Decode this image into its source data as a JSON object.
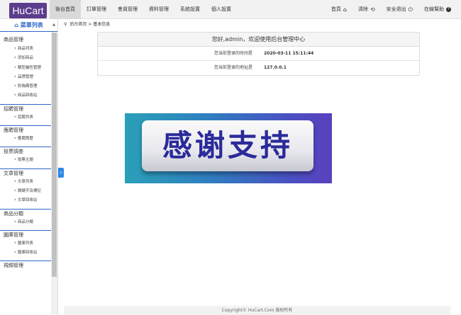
{
  "header": {
    "logo": "HuCart",
    "nav": [
      "後台首頁",
      "訂單管理",
      "會員管理",
      "資料管理",
      "系統設置",
      "個人設置"
    ],
    "right": [
      {
        "label": "首頁",
        "icon": "⌂"
      },
      {
        "label": "清除",
        "icon": "⟲"
      },
      {
        "label": "安全退出",
        "icon": "⏻"
      },
      {
        "label": "在線幫助",
        "icon": "?"
      }
    ]
  },
  "sidebar": {
    "title": "菜單列表",
    "groups": [
      {
        "title": "商品管理",
        "items": [
          "商品列表",
          "添加商品",
          "類型屬性管理",
          "品牌管理",
          "防偽碼管理",
          "商品回收站"
        ]
      },
      {
        "title": "招聘管理",
        "items": [
          "招聘列表"
        ]
      },
      {
        "title": "應聘管理",
        "items": [
          "應聘簡歷"
        ]
      },
      {
        "title": "投票調查",
        "items": [
          "投票主題"
        ]
      },
      {
        "title": "文章管理",
        "items": [
          "文章列表",
          "關鍵字及標記",
          "文章回收站"
        ]
      },
      {
        "title": "商品分類",
        "items": [
          "商品分類"
        ]
      },
      {
        "title": "圖庫管理",
        "items": [
          "圖庫列表",
          "圖庫回收站"
        ]
      },
      {
        "title": "視頻管理",
        "items": []
      }
    ]
  },
  "breadcrumb": {
    "home": "后台首页",
    "sep": ">",
    "current": "基本信息"
  },
  "info": {
    "greeting": "您好,admin，欢迎使用后台管理中心",
    "rows": [
      {
        "label": "您当前登录的时间是",
        "value": "2020-03-11 15:11:44"
      },
      {
        "label": "您当前登录的地址是",
        "value": "127.0.0.1"
      }
    ]
  },
  "banner": {
    "text": "感谢支持"
  },
  "footer": "Copyright© HuCart.Com 版权所有"
}
